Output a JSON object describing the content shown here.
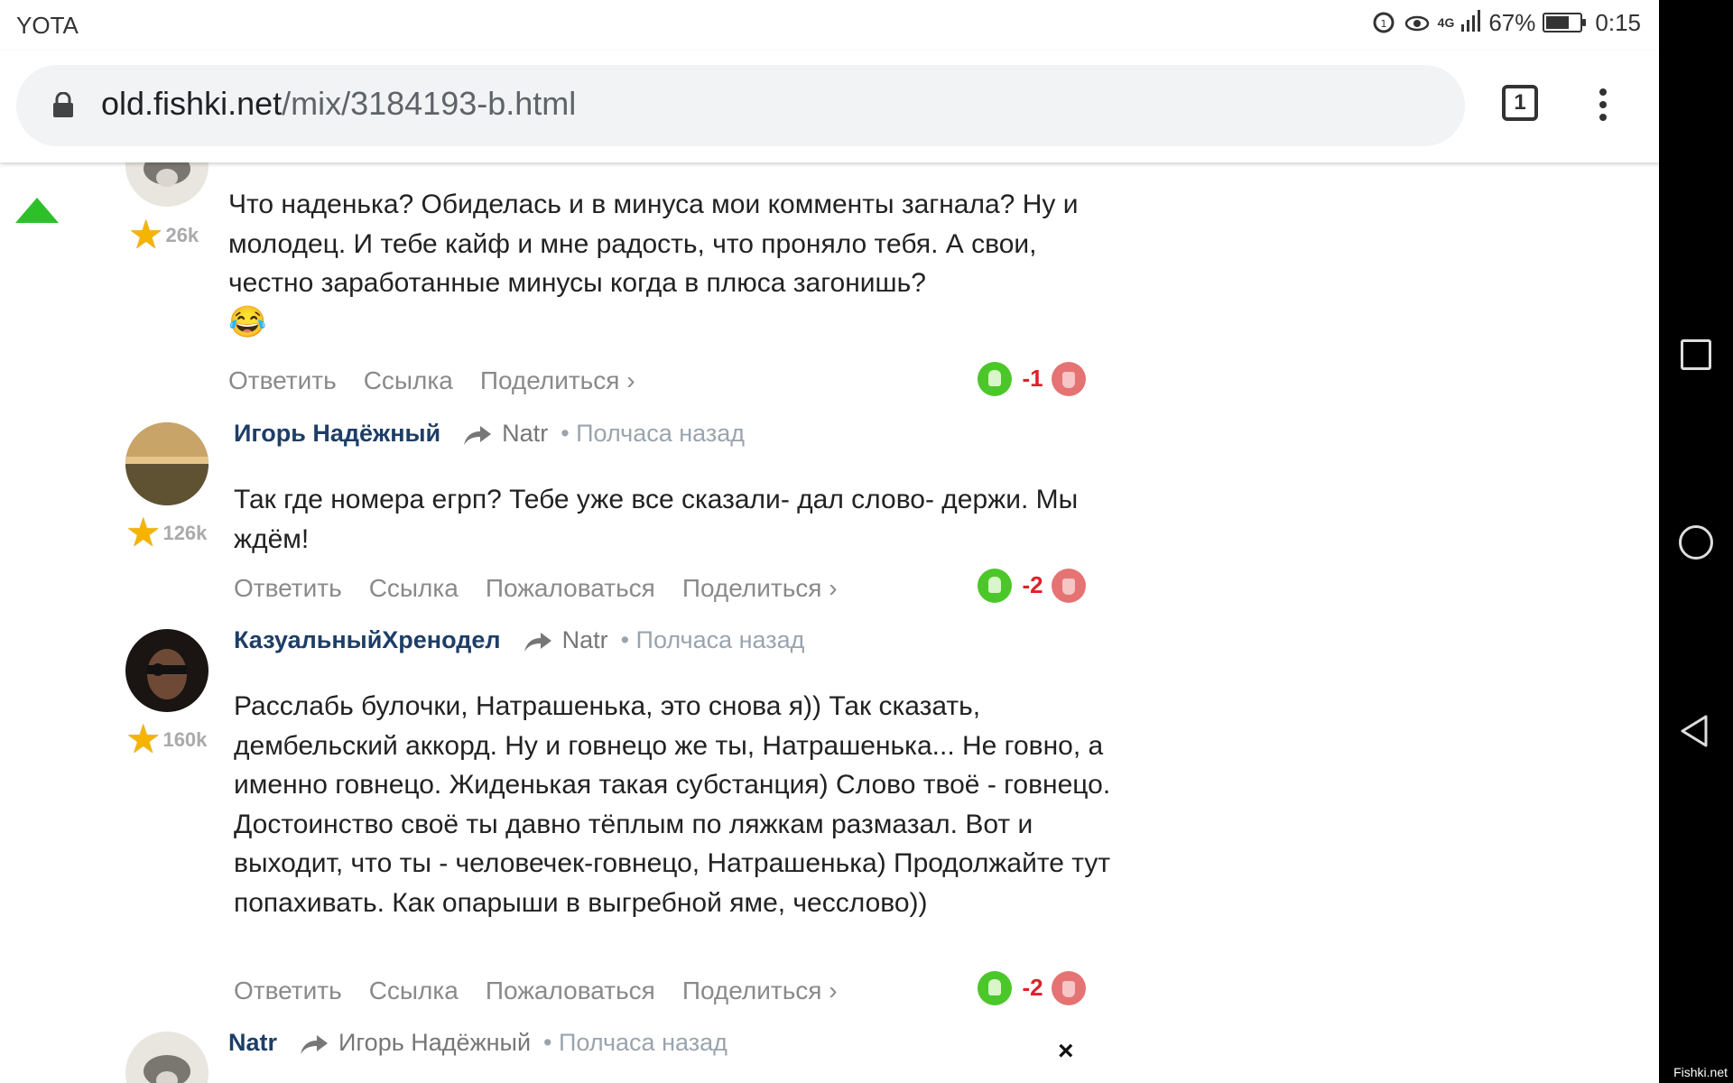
{
  "status_bar": {
    "carrier": "YOTA",
    "network": "4G",
    "battery": "67%",
    "battery_level": 0.67,
    "time": "0:15"
  },
  "browser": {
    "url_host": "old.fishki.net",
    "url_path": "/mix/3184193-b.html",
    "tab_count": "1"
  },
  "comments": [
    {
      "author": "",
      "rating": "26k",
      "text": "Что наденька? Обиделась и в минуса мои комменты загнала? Ну и молодец. И тебе кайф и мне радость, что проняло тебя. А свои, честно заработанные минусы когда в плюса загонишь?",
      "emoji": "😂",
      "actions": [
        "Ответить",
        "Ссылка",
        "Поделиться ›"
      ],
      "score": "-1"
    },
    {
      "author": "Игорь Надёжный",
      "reply_to": "Natr",
      "time": "• Полчаса назад",
      "rating": "126k",
      "text": "Так где номера егрп? Тебе уже все сказали- дал слово- держи. Мы ждём!",
      "actions": [
        "Ответить",
        "Ссылка",
        "Пожаловаться",
        "Поделиться ›"
      ],
      "score": "-2"
    },
    {
      "author": "КазуальныйХренодел",
      "reply_to": "Natr",
      "time": "• Полчаса назад",
      "rating": "160k",
      "text": "Расслабь булочки, Натрашенька, это снова я)) Так сказать, дембельский аккорд. Ну и говнецо же ты, Натрашенька... Не говно, а именно говнецо. Жиденькая такая субстанция) Слово твоё - говнецо. Достоинство своё ты давно тёплым по ляжкам размазал. Вот и выходит, что ты - человечек-говнецо, Натрашенька) Продолжайте тут попахивать. Как опарыши в выгребной яме, чесслово))",
      "actions": [
        "Ответить",
        "Ссылка",
        "Пожаловаться",
        "Поделиться ›"
      ],
      "score": "-2"
    },
    {
      "author": "Natr",
      "reply_to": "Игорь Надёжный",
      "time": "• Полчаса назад"
    }
  ],
  "close_label": "×",
  "watermark": "Fishki.net",
  "colors": {
    "author": "#1e3e66",
    "vote_up": "#4bc72a",
    "vote_down": "#e57373",
    "score": "#e0202a",
    "scroll_top_arrow": "#2ec02b"
  },
  "icons": [
    "lock-icon",
    "tab-switcher-icon",
    "more-vert-icon",
    "scroll-top-icon",
    "star-icon",
    "reply-arrow-icon",
    "thumb-up-icon",
    "thumb-down-icon",
    "close-icon",
    "nav-recent-icon",
    "nav-home-icon",
    "nav-back-icon"
  ]
}
